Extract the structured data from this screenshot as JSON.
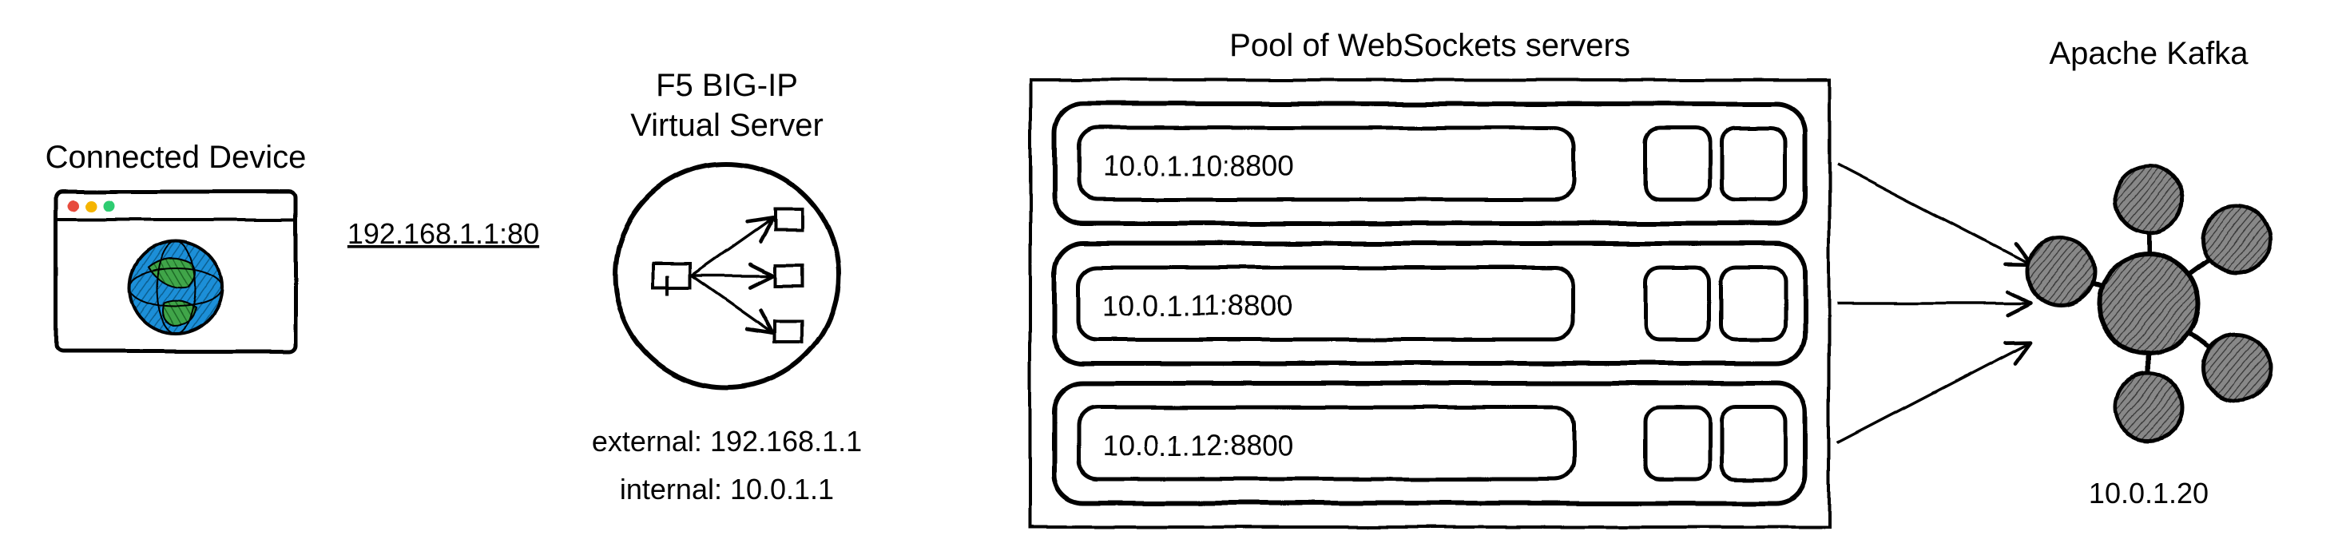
{
  "device": {
    "title": "Connected Device",
    "connect_label": "192.168.1.1:80"
  },
  "lb": {
    "title_line1": "F5 BIG-IP",
    "title_line2": "Virtual Server",
    "external_label": "external: 192.168.1.1",
    "internal_label": "internal: 10.0.1.1"
  },
  "pool": {
    "title": "Pool of WebSockets servers",
    "servers": [
      {
        "addr": "10.0.1.10:8800"
      },
      {
        "addr": "10.0.1.11:8800"
      },
      {
        "addr": "10.0.1.12:8800"
      }
    ]
  },
  "kafka": {
    "title": "Apache Kafka",
    "addr": "10.0.1.20"
  }
}
